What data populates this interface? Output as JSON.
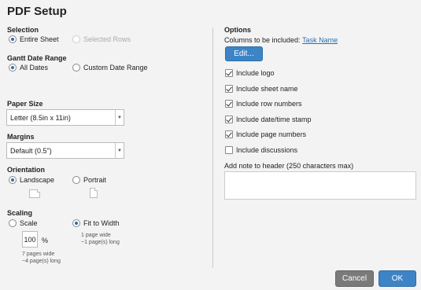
{
  "dialog": {
    "title": "PDF Setup"
  },
  "selection": {
    "label": "Selection",
    "entire_sheet": "Entire Sheet",
    "selected_rows": "Selected Rows"
  },
  "gantt": {
    "label": "Gantt Date Range",
    "all_dates": "All Dates",
    "custom": "Custom Date Range"
  },
  "paper_size": {
    "label": "Paper Size",
    "value": "Letter (8.5in x 11in)"
  },
  "margins": {
    "label": "Margins",
    "value": "Default (0.5\")"
  },
  "orientation": {
    "label": "Orientation",
    "landscape": "Landscape",
    "portrait": "Portrait"
  },
  "scaling": {
    "label": "Scaling",
    "scale": "Scale",
    "fit": "Fit to Width",
    "scale_value": "100",
    "percent": "%",
    "scale_note_1": "7 pages wide",
    "scale_note_2": "~4 page(s) long",
    "fit_note_1": "1 page wide",
    "fit_note_2": "~1 page(s) long"
  },
  "options": {
    "label": "Options",
    "columns_prefix": "Columns to be included:",
    "columns_link": "Task Name",
    "edit": "Edit...",
    "items": [
      {
        "label": "Include logo",
        "checked": true
      },
      {
        "label": "Include sheet name",
        "checked": true
      },
      {
        "label": "Include row numbers",
        "checked": true
      },
      {
        "label": "Include date/time stamp",
        "checked": true
      },
      {
        "label": "Include page numbers",
        "checked": true
      },
      {
        "label": "Include discussions",
        "checked": false
      }
    ],
    "note_label": "Add note to header (250 characters max)",
    "note_value": ""
  },
  "footer": {
    "cancel": "Cancel",
    "ok": "OK"
  },
  "colors": {
    "accent": "#3d84c6",
    "cancel": "#7a7a7a"
  }
}
